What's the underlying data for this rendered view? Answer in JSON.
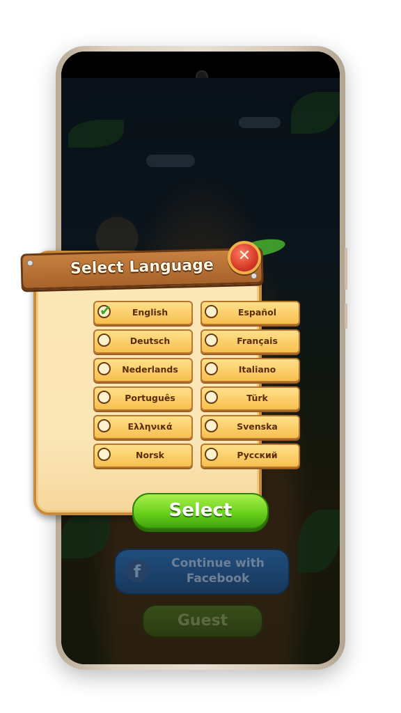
{
  "dialog": {
    "title": "Select Language",
    "close_label": "✕",
    "languages": [
      {
        "label": "English",
        "selected": true
      },
      {
        "label": "Español",
        "selected": false
      },
      {
        "label": "Deutsch",
        "selected": false
      },
      {
        "label": "Français",
        "selected": false
      },
      {
        "label": "Nederlands",
        "selected": false
      },
      {
        "label": "Italiano",
        "selected": false
      },
      {
        "label": "Português",
        "selected": false
      },
      {
        "label": "Türk",
        "selected": false
      },
      {
        "label": "Ελληνικά",
        "selected": false
      },
      {
        "label": "Svenska",
        "selected": false
      },
      {
        "label": "Norsk",
        "selected": false
      },
      {
        "label": "Русский",
        "selected": false
      }
    ],
    "select_label": "Select",
    "check_glyph": "✔"
  },
  "login": {
    "facebook_icon": "f",
    "facebook_label": "Continue with Facebook",
    "guest_label": "Guest"
  },
  "colors": {
    "select_green": "#6ad21c",
    "wood": "#a8632b",
    "close_red": "#d53a27",
    "facebook_blue": "#1e5a9a"
  }
}
